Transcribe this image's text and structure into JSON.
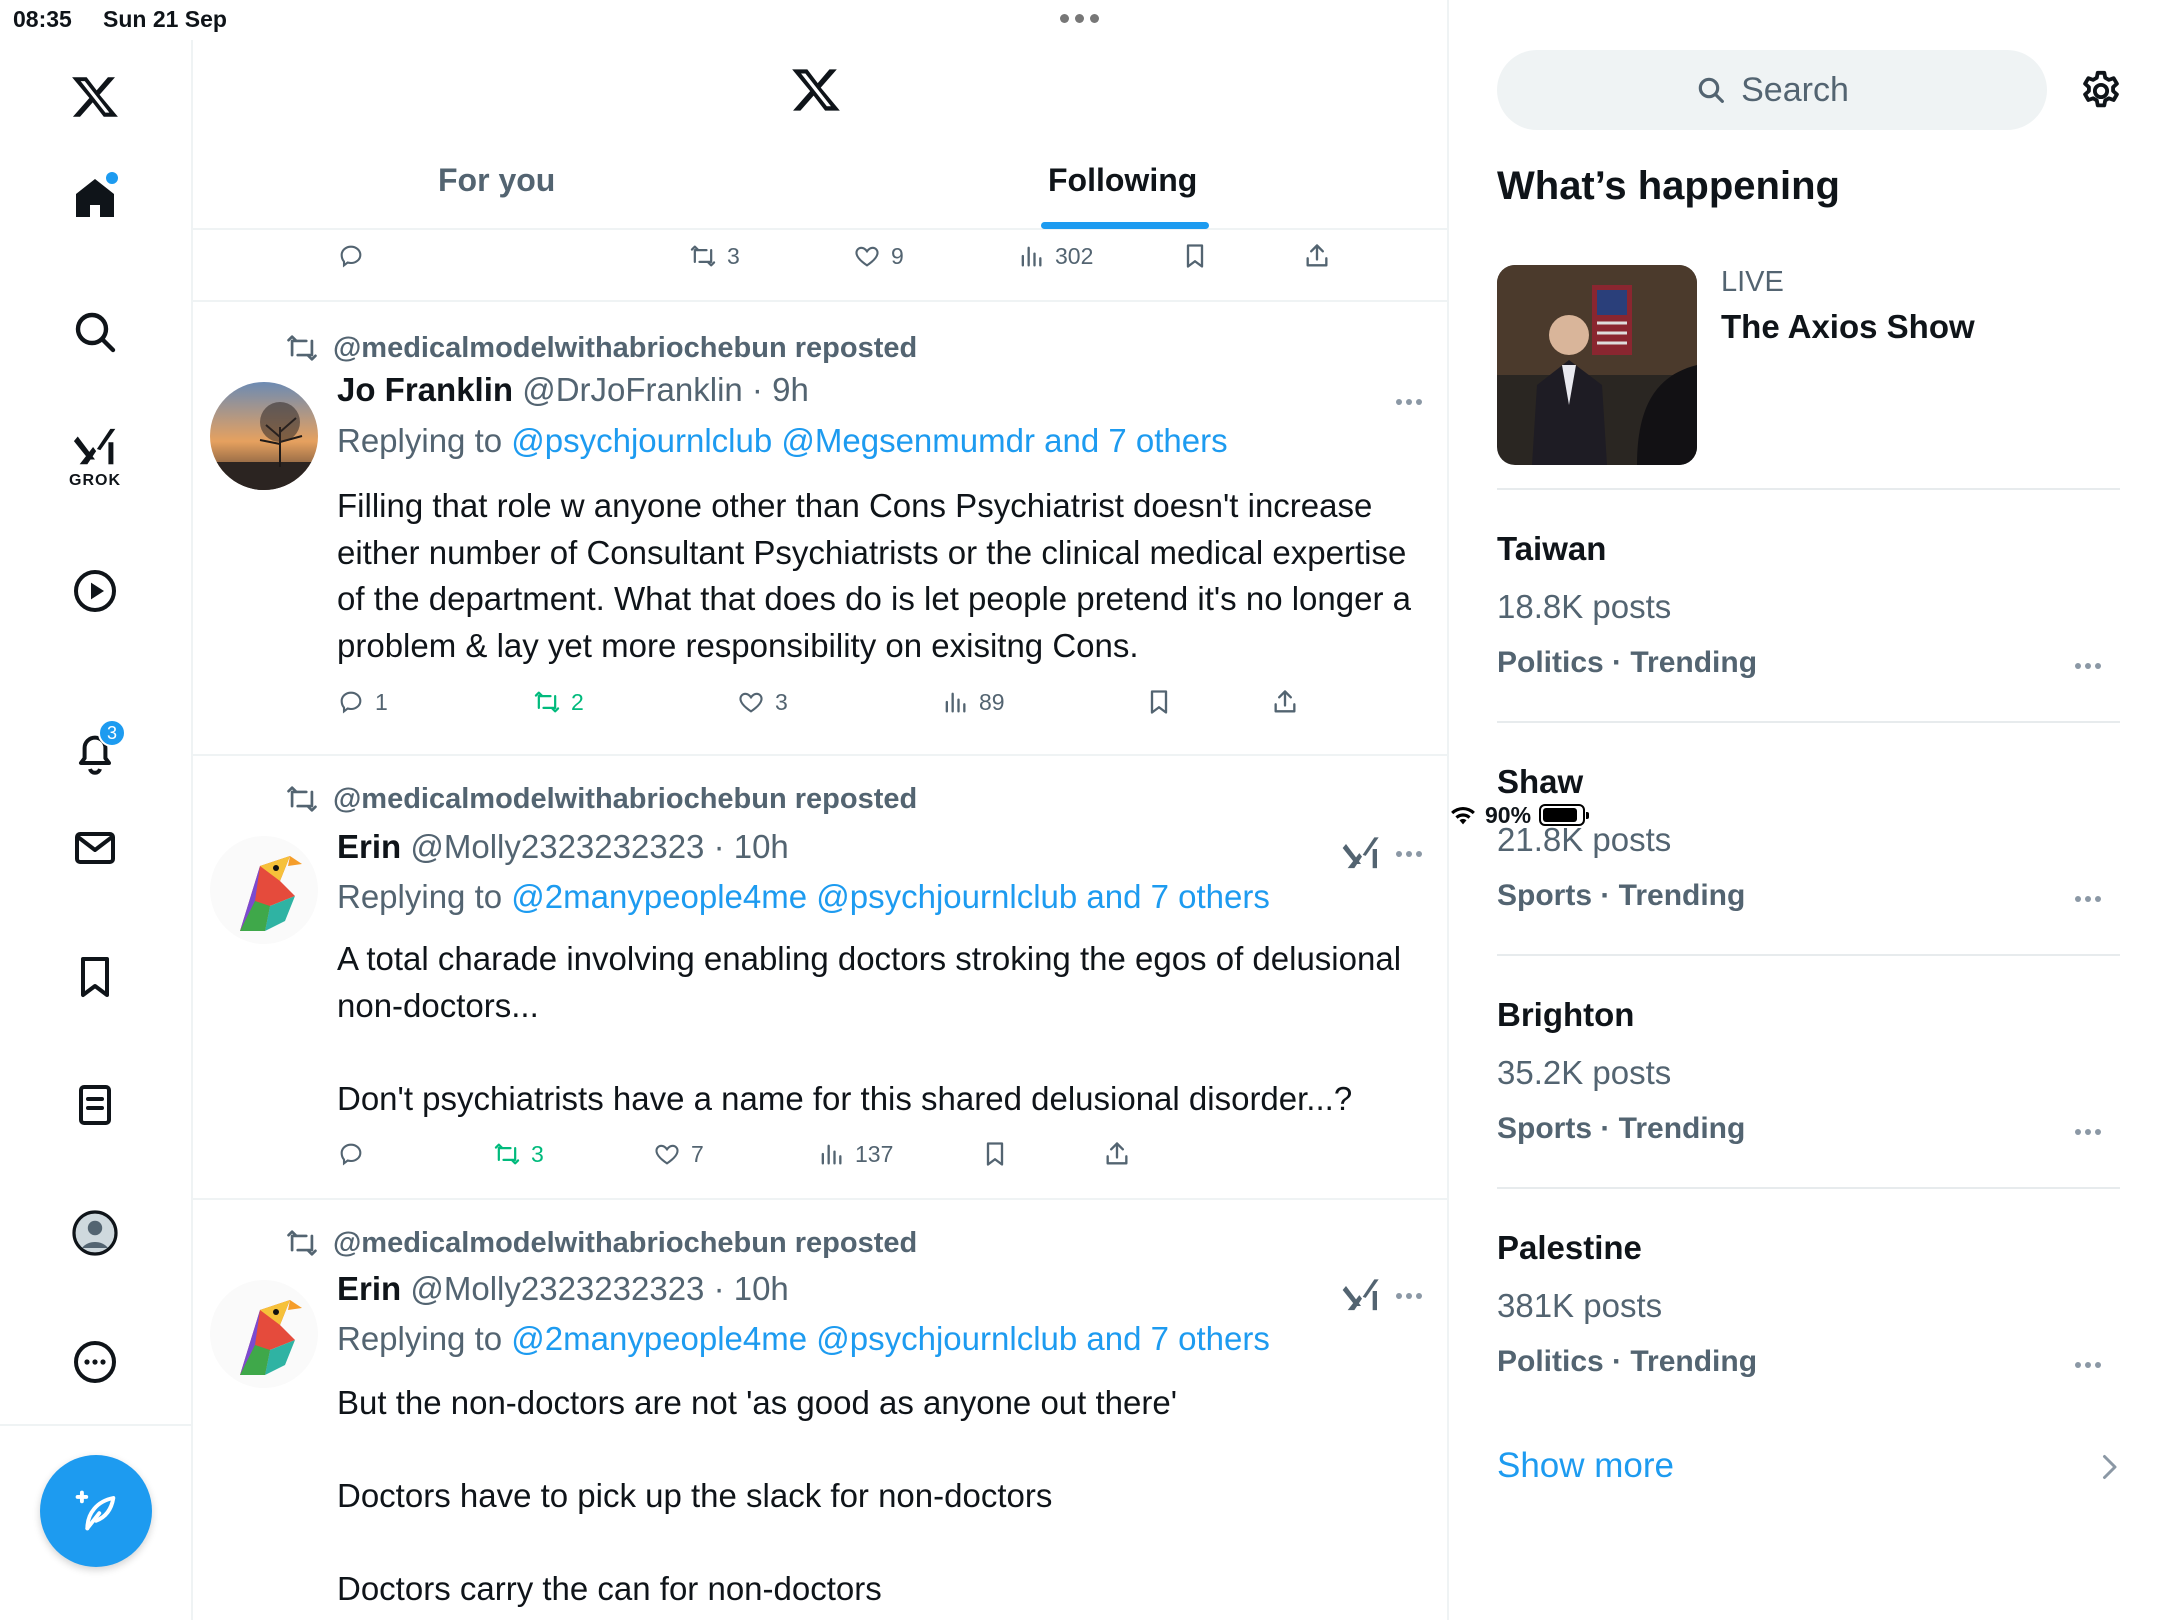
{
  "status": {
    "time": "08:35",
    "date": "Sun 21 Sep",
    "battery": "90%",
    "battery_level": 0.9
  },
  "nav": {
    "grok_label": "GROK",
    "notifications_count": "3"
  },
  "tabs": {
    "for_you": "For you",
    "following": "Following"
  },
  "top_actions": {
    "retweets": "3",
    "likes": "9",
    "views": "302"
  },
  "posts": [
    {
      "repost_by": "@medicalmodelwithabriochebun reposted",
      "name": "Jo Franklin",
      "meta": "@DrJoFranklin · 9h",
      "replying_prefix": "Replying to ",
      "replying_to": "@psychjournlclub @Megsenmumdr and 7 others",
      "text": "Filling that role w anyone other than Cons Psychiatrist doesn't increase either number of Consultant Psychiatrists or the clinical medical expertise of the department. What that does do is let people pretend it's no longer a problem & lay yet more responsibility on exisitng Cons.",
      "replies": "1",
      "retweets": "2",
      "likes": "3",
      "views": "89"
    },
    {
      "repost_by": "@medicalmodelwithabriochebun reposted",
      "name": "Erin",
      "meta": "@Molly2323232323 · 10h",
      "replying_prefix": "Replying to ",
      "replying_to": "@2manypeople4me @psychjournlclub and 7 others",
      "text": "A total charade involving enabling doctors stroking the egos of delusional non-doctors...\n\nDon't psychiatrists have a name for this shared delusional disorder...?",
      "retweets": "3",
      "likes": "7",
      "views": "137"
    },
    {
      "repost_by": "@medicalmodelwithabriochebun reposted",
      "name": "Erin",
      "meta": "@Molly2323232323 · 10h",
      "replying_prefix": "Replying to ",
      "replying_to": "@2manypeople4me @psychjournlclub and 7 others",
      "text": "But the non-doctors are not 'as good as anyone out there'\n\nDoctors have to pick up the slack for non-doctors\n\nDoctors carry the can for non-doctors"
    }
  ],
  "sidebar": {
    "search_placeholder": "Search",
    "title": "What’s happening",
    "live": {
      "label": "LIVE",
      "title": "The Axios Show"
    },
    "trends": [
      {
        "name": "Taiwan",
        "posts": "18.8K posts",
        "category": "Politics · Trending"
      },
      {
        "name": "Shaw",
        "posts": "21.8K posts",
        "category": "Sports · Trending"
      },
      {
        "name": "Brighton",
        "posts": "35.2K posts",
        "category": "Sports · Trending"
      },
      {
        "name": "Palestine",
        "posts": "381K posts",
        "category": "Politics · Trending"
      }
    ],
    "show_more": "Show more"
  },
  "colors": {
    "accent": "#1d9bf0",
    "repost_green": "#00ba7c",
    "muted": "#536471"
  }
}
